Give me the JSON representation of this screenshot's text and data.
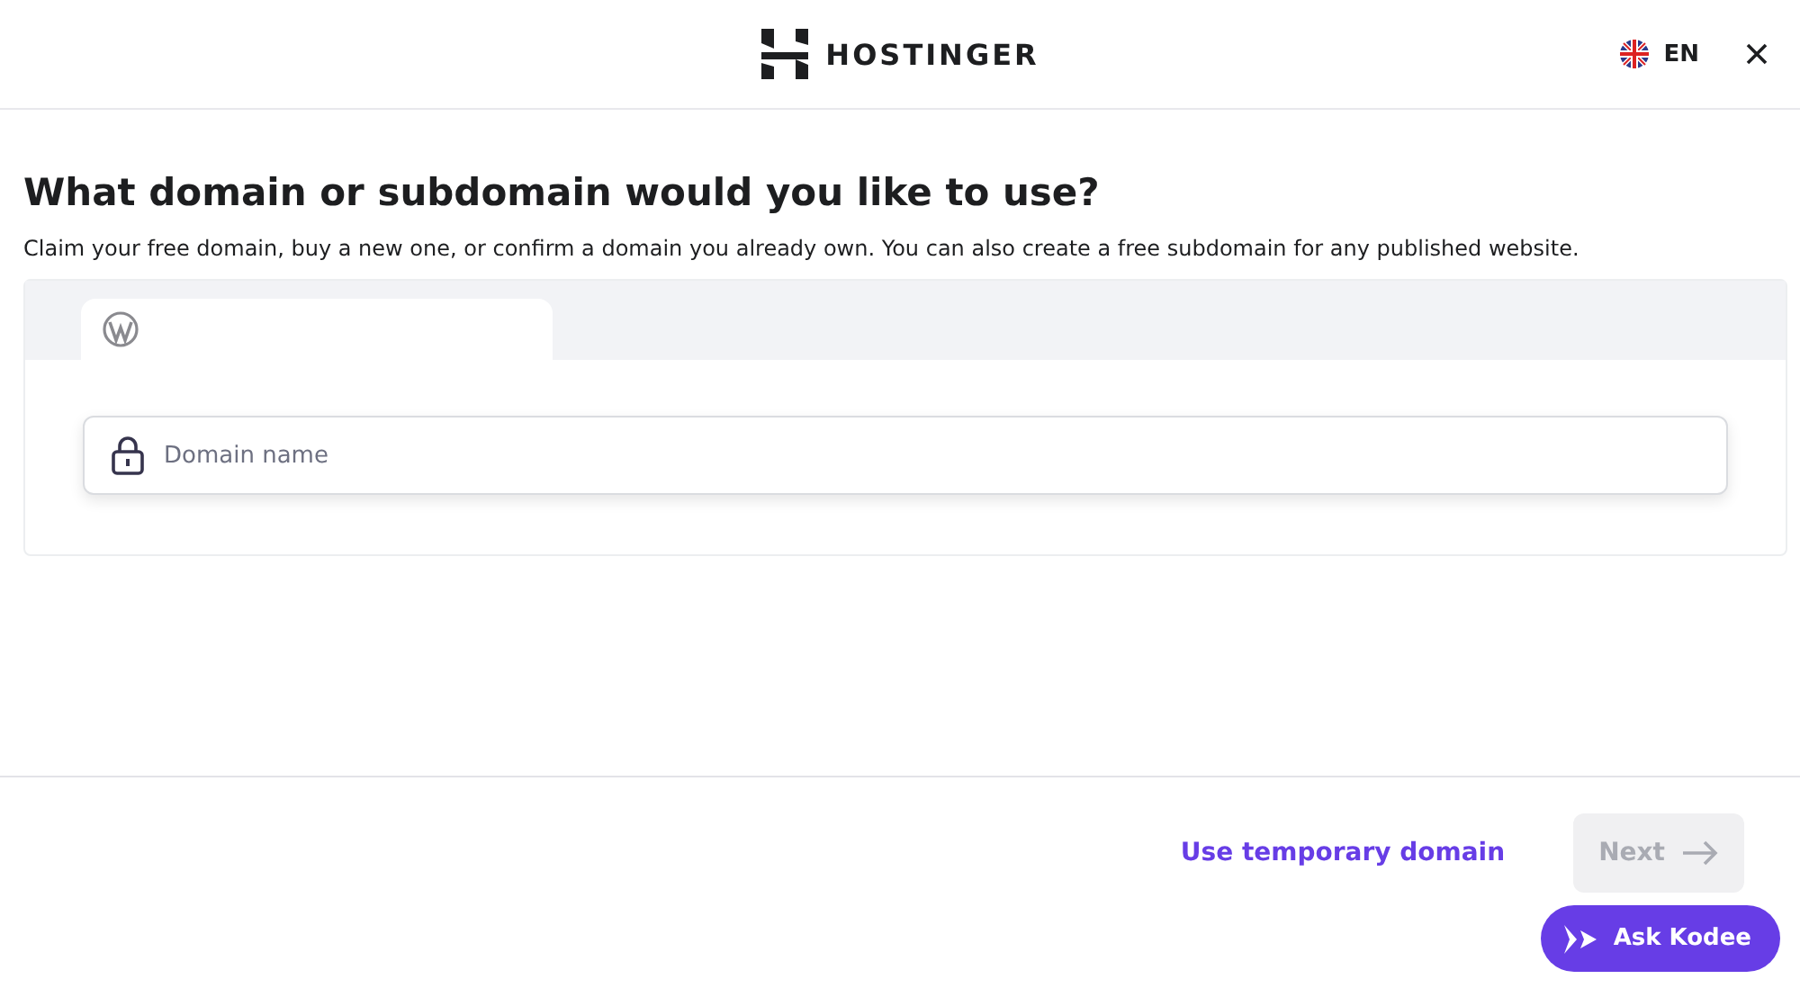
{
  "header": {
    "logo": "HOSTINGER",
    "language": "EN"
  },
  "heading": "What domain or subdomain would you like to use?",
  "description": "Claim your free domain, buy a new one, or confirm a domain you already own. You can also create a free subdomain for any published website.",
  "tabs": [
    {
      "selected": true
    }
  ],
  "domain_field": {
    "placeholder": "Domain name"
  },
  "footer": {
    "link": "Use temporary domain",
    "next": {
      "label": "Next",
      "disabled": true
    }
  },
  "assistant": {
    "label": "Ask Kodee"
  }
}
